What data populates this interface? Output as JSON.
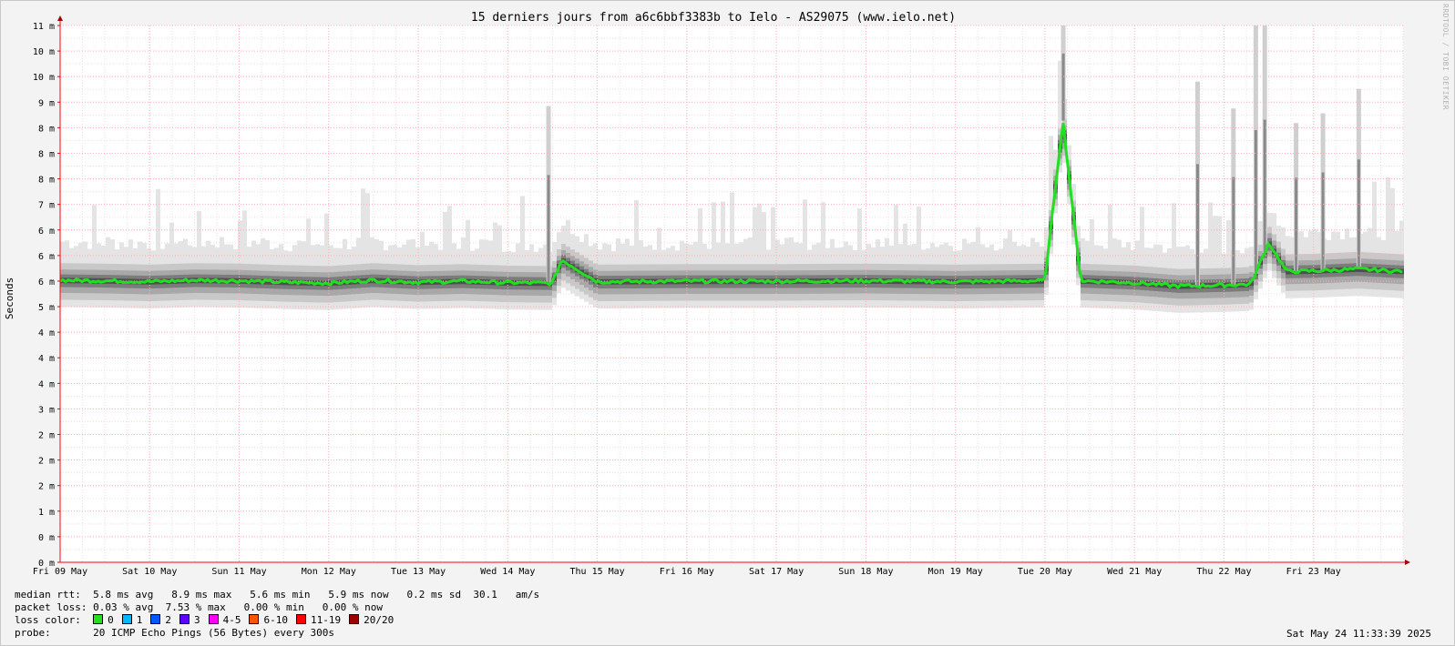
{
  "chart_data": {
    "type": "area",
    "title": "15 derniers jours from a6c6bbf3383b to Ielo - AS29075 (www.ielo.net)",
    "ylabel": "Seconds",
    "xlabel": "",
    "y_tick_labels": [
      "0 m",
      "0 m",
      "1 m",
      "2 m",
      "2 m",
      "2 m",
      "3 m",
      "4 m",
      "4 m",
      "4 m",
      "5 m",
      "6 m",
      "6 m",
      "6 m",
      "7 m",
      "8 m",
      "8 m",
      "8 m",
      "9 m",
      "10 m",
      "10 m",
      "11 m"
    ],
    "ylim_ms": [
      0,
      11.0
    ],
    "x_tick_labels": [
      "Fri 09 May",
      "Sat 10 May",
      "Sun 11 May",
      "Mon 12 May",
      "Tue 13 May",
      "Wed 14 May",
      "Thu 15 May",
      "Fri 16 May",
      "Sat 17 May",
      "Sun 18 May",
      "Mon 19 May",
      "Tue 20 May",
      "Wed 21 May",
      "Thu 22 May",
      "Fri 23 May"
    ],
    "xlim_days": [
      0,
      15
    ],
    "grid": true,
    "series": [
      {
        "name": "median rtt",
        "color": "#20e020",
        "x_days": [
          0,
          0.5,
          1,
          1.5,
          2,
          2.5,
          3,
          3.5,
          4,
          4.5,
          5,
          5.5,
          5.6,
          6,
          7,
          8,
          9,
          10,
          11,
          11.2,
          11.4,
          12,
          12.5,
          13,
          13.3,
          13.5,
          13.7,
          14,
          14.5,
          15
        ],
        "values_ms": [
          5.78,
          5.77,
          5.75,
          5.78,
          5.77,
          5.74,
          5.72,
          5.78,
          5.74,
          5.76,
          5.73,
          5.72,
          6.2,
          5.75,
          5.76,
          5.76,
          5.77,
          5.75,
          5.77,
          9.05,
          5.77,
          5.73,
          5.66,
          5.68,
          5.7,
          6.55,
          5.96,
          5.97,
          6.01,
          5.96
        ]
      }
    ],
    "smoke_spikes": [
      {
        "x_day": 5.45,
        "top_ms": 9.35
      },
      {
        "x_day": 11.2,
        "top_ms": 11.0
      },
      {
        "x_day": 12.7,
        "top_ms": 9.85
      },
      {
        "x_day": 13.1,
        "top_ms": 9.3
      },
      {
        "x_day": 13.35,
        "top_ms": 11.0
      },
      {
        "x_day": 13.45,
        "top_ms": 11.0
      },
      {
        "x_day": 13.8,
        "top_ms": 9.0
      },
      {
        "x_day": 14.1,
        "top_ms": 9.2
      },
      {
        "x_day": 14.5,
        "top_ms": 9.7
      }
    ],
    "axis_color": "#ff0000",
    "grid_color": "#ffb0b0",
    "loss_colors": [
      {
        "label": "0",
        "color": "#20e020"
      },
      {
        "label": "1",
        "color": "#00b8ff"
      },
      {
        "label": "2",
        "color": "#0059ff"
      },
      {
        "label": "3",
        "color": "#5e00ff"
      },
      {
        "label": "4-5",
        "color": "#ff00ff"
      },
      {
        "label": "6-10",
        "color": "#ff5500"
      },
      {
        "label": "11-19",
        "color": "#ff0000"
      },
      {
        "label": "20/20",
        "color": "#a10000"
      }
    ]
  },
  "legend": {
    "median_label": "median rtt:",
    "median_values": "5.8 ms avg   8.9 ms max   5.6 ms min   5.9 ms now   0.2 ms sd  30.1   am/s",
    "loss_label": "packet loss:",
    "loss_values": "0.03 % avg  7.53 % max   0.00 % min   0.00 % now",
    "color_label": "loss color:",
    "probe_label": "probe:",
    "probe_values": "20 ICMP Echo Pings (56 Bytes) every 300s"
  },
  "timestamp": "Sat May 24 11:33:39 2025",
  "watermark": "RRDTOOL / TOBI OETIKER"
}
